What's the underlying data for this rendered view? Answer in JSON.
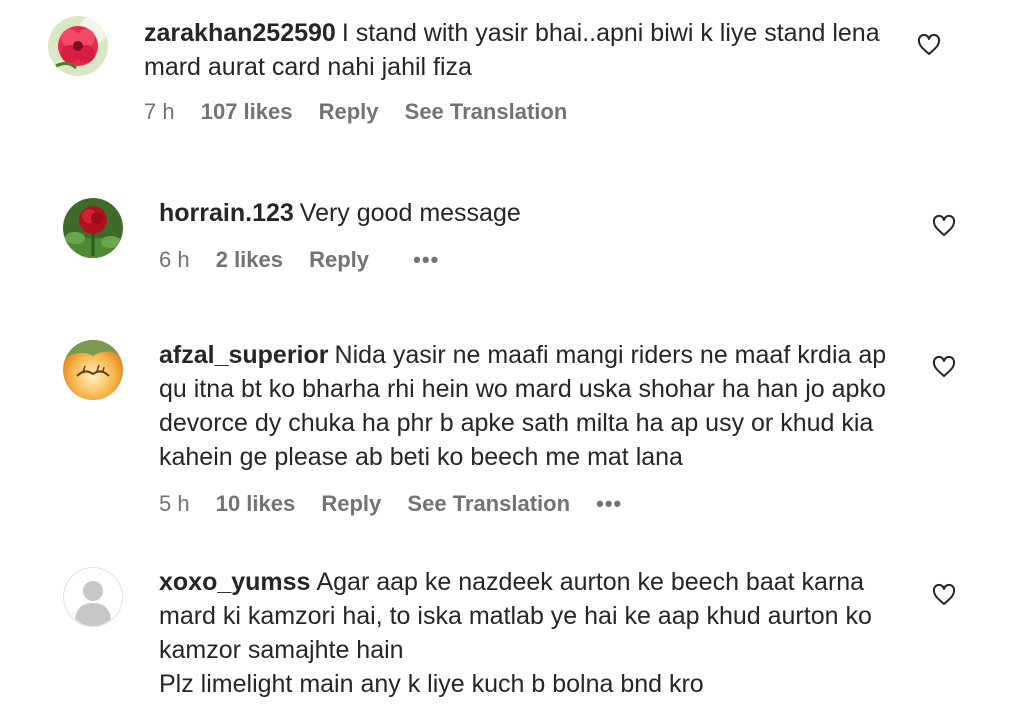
{
  "comments": [
    {
      "username": "zarakhan252590",
      "text": "I stand with yasir bhai..apni biwi k liye stand lena mard aurat card nahi jahil fiza",
      "time": "7 h",
      "likes": "107 likes",
      "reply": "Reply",
      "translate": "See Translation",
      "avatar_icon": "flower-photo"
    },
    {
      "username": "horrain.123",
      "text": "Very good message",
      "time": "6 h",
      "likes": "2 likes",
      "reply": "Reply",
      "more": "•••",
      "avatar_icon": "rose-photo"
    },
    {
      "username": "afzal_superior",
      "text": "Nida yasir ne maafi mangi riders ne maaf krdia ap qu itna bt ko bharha rhi hein wo mard uska shohar ha han jo apko devorce dy chuka ha phr b apke sath milta ha ap usy or khud kia kahein ge please ab beti ko beech me mat lana",
      "time": "5 h",
      "likes": "10 likes",
      "reply": "Reply",
      "translate": "See Translation",
      "more": "•••",
      "avatar_icon": "calligraphy-photo"
    },
    {
      "username": "xoxo_yumss",
      "text": "Agar aap ke nazdeek aurton ke beech baat karna mard ki kamzori hai, to iska matlab ye hai ke aap khud aurton ko kamzor samajhte hain",
      "text2": "Plz limelight main any k liye kuch b bolna bnd kro",
      "avatar_icon": "default-user-avatar"
    }
  ],
  "colors": {
    "text": "#262626",
    "meta": "#737373",
    "avatar_default": "#dbdbdb"
  }
}
